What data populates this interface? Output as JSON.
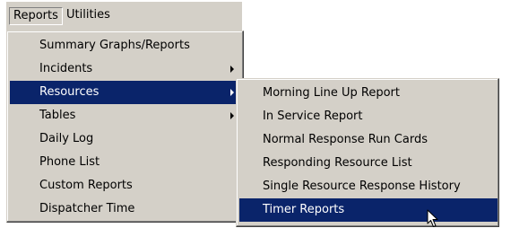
{
  "menubar": {
    "items": [
      "Reports",
      "Utilities"
    ]
  },
  "reports_menu": {
    "items": [
      {
        "label": "Summary Graphs/Reports",
        "submenu": false
      },
      {
        "label": "Incidents",
        "submenu": true
      },
      {
        "label": "Resources",
        "submenu": true,
        "highlighted": true
      },
      {
        "label": "Tables",
        "submenu": true
      },
      {
        "label": "Daily Log",
        "submenu": false
      },
      {
        "label": "Phone List",
        "submenu": false
      },
      {
        "label": "Custom Reports",
        "submenu": false
      },
      {
        "label": "Dispatcher Time",
        "submenu": false
      }
    ]
  },
  "resources_submenu": {
    "items": [
      {
        "label": "Morning Line Up Report"
      },
      {
        "label": "In Service Report"
      },
      {
        "label": "Normal Response Run Cards"
      },
      {
        "label": "Responding Resource List"
      },
      {
        "label": "Single Resource Response History"
      },
      {
        "label": "Timer Reports",
        "highlighted": true
      }
    ]
  },
  "colors": {
    "menu_bg": "#d4d0c8",
    "highlight": "#0a246a",
    "highlight_text": "#ffffff"
  },
  "icons": {
    "submenu_arrow": "arrow-right-icon",
    "cursor": "mouse-pointer-icon"
  }
}
